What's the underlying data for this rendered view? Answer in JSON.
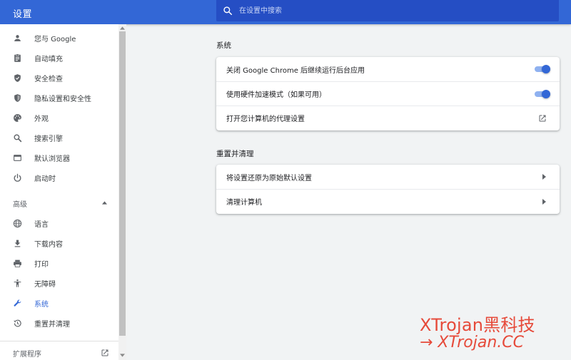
{
  "header": {
    "title": "设置",
    "search": {
      "placeholder": "在设置中搜索",
      "value": ""
    }
  },
  "sidebar": {
    "items": [
      {
        "label": "您与 Google",
        "icon": "person-icon"
      },
      {
        "label": "自动填充",
        "icon": "clipboard-icon"
      },
      {
        "label": "安全检查",
        "icon": "shield-check-icon"
      },
      {
        "label": "隐私设置和安全性",
        "icon": "shield-icon"
      },
      {
        "label": "外观",
        "icon": "palette-icon"
      },
      {
        "label": "搜索引擎",
        "icon": "search-icon"
      },
      {
        "label": "默认浏览器",
        "icon": "browser-icon"
      },
      {
        "label": "启动时",
        "icon": "power-icon"
      }
    ],
    "advanced": {
      "label": "高级",
      "expanded": true,
      "items": [
        {
          "label": "语言",
          "icon": "globe-icon"
        },
        {
          "label": "下载内容",
          "icon": "download-icon"
        },
        {
          "label": "打印",
          "icon": "printer-icon"
        },
        {
          "label": "无障碍",
          "icon": "accessibility-icon"
        },
        {
          "label": "系统",
          "icon": "wrench-icon",
          "active": true
        },
        {
          "label": "重置并清理",
          "icon": "history-icon"
        }
      ]
    },
    "extensions": {
      "label": "扩展程序",
      "icon": "open-in-new-icon"
    }
  },
  "main": {
    "system": {
      "title": "系统",
      "rows": [
        {
          "label": "关闭 Google Chrome 后继续运行后台应用",
          "control": "toggle",
          "on": true
        },
        {
          "label": "使用硬件加速模式（如果可用）",
          "control": "toggle",
          "on": true
        },
        {
          "label": "打开您计算机的代理设置",
          "control": "open-in-new-icon"
        }
      ]
    },
    "reset": {
      "title": "重置并清理",
      "rows": [
        {
          "label": "将设置还原为原始默认设置",
          "control": "arrow-right-icon"
        },
        {
          "label": "清理计算机",
          "control": "arrow-right-icon"
        }
      ]
    }
  },
  "watermark": {
    "line1": "XTrojan黑科技",
    "line2": "→ XTrojan.CC"
  },
  "colors": {
    "header_blue": "#3367d6",
    "search_blue": "#254ec4",
    "accent": "#3367d6",
    "page_bg": "#f1f3f4",
    "watermark_red": "#e64a3a"
  }
}
